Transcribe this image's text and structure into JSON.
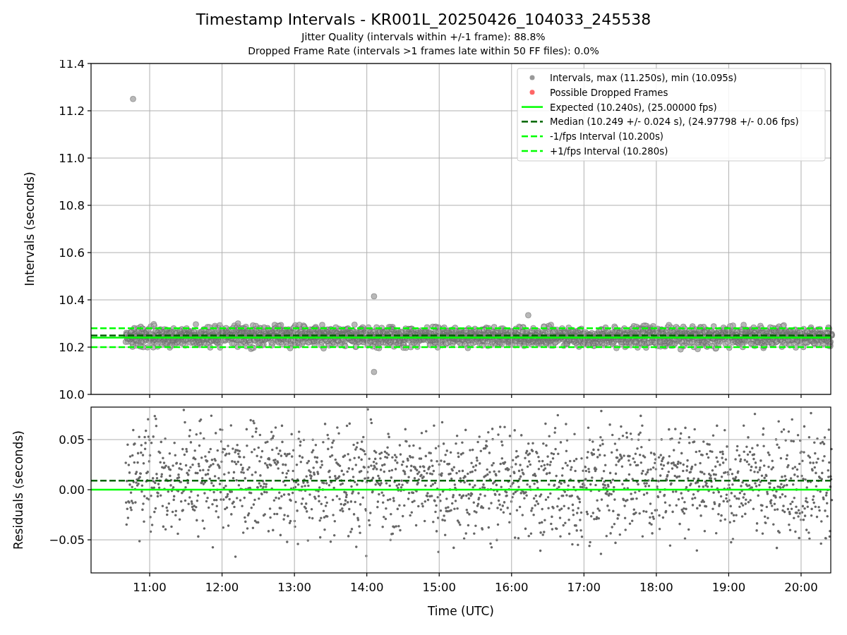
{
  "title": "Timestamp Intervals - KR001L_20250426_104033_245538",
  "subtitle_lines": [
    "Jitter Quality (intervals within +/-1 frame): 88.8%",
    "Dropped Frame Rate (intervals >1 frames late within 50 FF files): 0.0%"
  ],
  "intervals_plot": {
    "legend": [
      {
        "label": "Intervals, max (11.250s), min (10.095s)",
        "kind": "dot",
        "color": "#999999"
      },
      {
        "label": "Possible Dropped Frames",
        "kind": "dot",
        "color": "#ff6666"
      },
      {
        "label": "Expected (10.240s), (25.00000 fps)",
        "kind": "solid",
        "color": "#00ff00"
      },
      {
        "label": "Median (10.249 +/- 0.024 s), (24.97798 +/- 0.06 fps)",
        "kind": "dashed",
        "color": "#006400"
      },
      {
        "label": "-1/fps Interval (10.200s)",
        "kind": "dashed",
        "color": "#00ff00"
      },
      {
        "label": "+1/fps Interval (10.280s)",
        "kind": "dashed",
        "color": "#00ff00"
      }
    ],
    "chart_data": {
      "type": "line",
      "ylabel": "Intervals (seconds)",
      "x": [
        10.19,
        20.41
      ],
      "grid": true,
      "series": [
        {
          "color": "#00ff00",
          "line_style": "solid",
          "values": [
            10.24,
            10.24
          ]
        },
        {
          "color": "#006400",
          "line_style": "dashed",
          "values": [
            10.249,
            10.249
          ]
        },
        {
          "color": "#00ff00",
          "line_style": "dashed",
          "values": [
            10.2,
            10.2
          ]
        },
        {
          "color": "#00ff00",
          "line_style": "dashed",
          "values": [
            10.28,
            10.28
          ]
        }
      ],
      "xlim": [
        10.19,
        20.41
      ],
      "ylim": [
        10.0,
        11.4
      ],
      "yticks": [
        {
          "value": 10.0,
          "label": "10.0"
        },
        {
          "value": 10.2,
          "label": "10.2"
        },
        {
          "value": 10.4,
          "label": "10.4"
        },
        {
          "value": 10.6,
          "label": "10.6"
        },
        {
          "value": 10.8,
          "label": "10.8"
        },
        {
          "value": 11.0,
          "label": "11.0"
        },
        {
          "value": 11.2,
          "label": "11.2"
        },
        {
          "value": 11.4,
          "label": "11.4"
        }
      ]
    }
  },
  "residuals_plot": {
    "chart_data": {
      "type": "line",
      "xlabel": "Time (UTC)",
      "ylabel": "Residuals (seconds)",
      "x": [
        10.19,
        20.41
      ],
      "grid": true,
      "series": [
        {
          "color": "#00ff00",
          "line_style": "solid",
          "values": [
            0,
            0
          ]
        },
        {
          "color": "#006400",
          "line_style": "dashed",
          "values": [
            0.009,
            0.009
          ]
        }
      ],
      "xlim": [
        10.19,
        20.41
      ],
      "ylim": [
        -0.083,
        0.0824
      ],
      "xticks": [
        {
          "value": 11,
          "label": "11:00"
        },
        {
          "value": 12,
          "label": "12:00"
        },
        {
          "value": 13,
          "label": "13:00"
        },
        {
          "value": 14,
          "label": "14:00"
        },
        {
          "value": 15,
          "label": "15:00"
        },
        {
          "value": 16,
          "label": "16:00"
        },
        {
          "value": 17,
          "label": "17:00"
        },
        {
          "value": 18,
          "label": "18:00"
        },
        {
          "value": 19,
          "label": "19:00"
        },
        {
          "value": 20,
          "label": "20:00"
        }
      ],
      "yticks": [
        {
          "value": -0.05,
          "label": "−0.05"
        },
        {
          "value": 0,
          "label": "0.00"
        },
        {
          "value": 0.05,
          "label": "0.05"
        }
      ]
    }
  }
}
